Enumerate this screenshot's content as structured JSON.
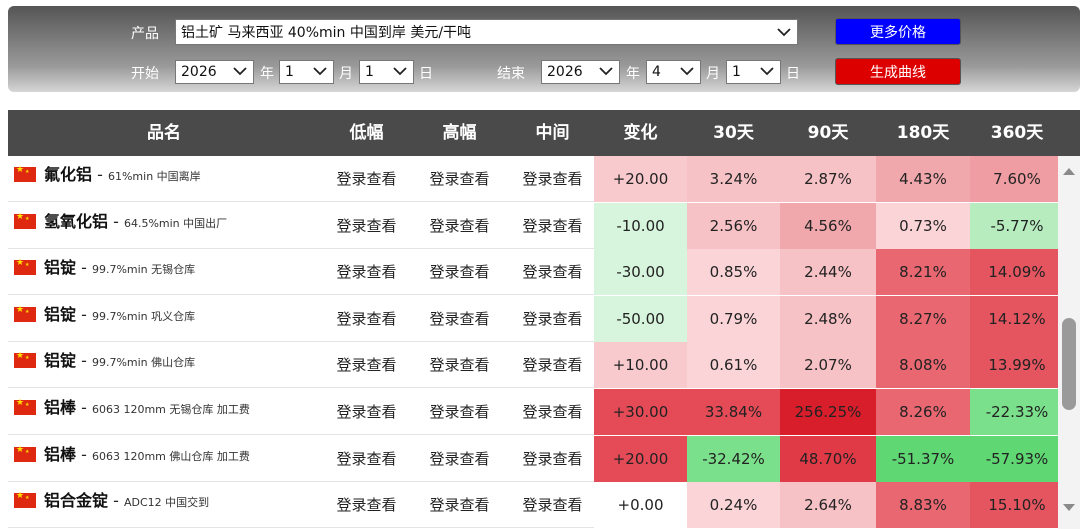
{
  "form": {
    "product_label": "产品",
    "product_value": "铝土矿 马来西亚 40%min 中国到岸 美元/干吨",
    "start_label": "开始",
    "end_label": "结束",
    "start": {
      "year": "2026",
      "month": "1",
      "day": "1"
    },
    "end": {
      "year": "2026",
      "month": "4",
      "day": "1"
    },
    "unit_year": "年",
    "unit_month": "月",
    "unit_day": "日",
    "more_price_button": "更多价格",
    "generate_curve_button": "生成曲线",
    "colors": {
      "more_price": "#0000ff",
      "generate_curve": "#dd0000"
    }
  },
  "table": {
    "headers": [
      "品名",
      "低幅",
      "高幅",
      "中间",
      "变化",
      "30天",
      "90天",
      "180天",
      "360天"
    ],
    "login_text": "登录查看",
    "rows": [
      {
        "name": "氟化铝",
        "spec": "61%min 中国离岸",
        "change": "+20.00",
        "d30": "3.24%",
        "d90": "2.87%",
        "d180": "4.43%",
        "d360": "7.60%",
        "colors": {
          "change": "#f8c9cd",
          "d30": "#f7c2c6",
          "d90": "#f7c2c6",
          "d180": "#f1a8ad",
          "d360": "#ef9ca2"
        }
      },
      {
        "name": "氢氧化铝",
        "spec": "64.5%min 中国出厂",
        "change": "-10.00",
        "d30": "2.56%",
        "d90": "4.56%",
        "d180": "0.73%",
        "d360": "-5.77%",
        "colors": {
          "change": "#d7f4dc",
          "d30": "#f7c2c6",
          "d90": "#f1a8ad",
          "d180": "#fad4d7",
          "d360": "#b7ecbf"
        }
      },
      {
        "name": "铝锭",
        "spec": "99.7%min 无锡仓库",
        "change": "-30.00",
        "d30": "0.85%",
        "d90": "2.44%",
        "d180": "8.21%",
        "d360": "14.09%",
        "colors": {
          "change": "#d7f4dc",
          "d30": "#fad4d7",
          "d90": "#f7c2c6",
          "d180": "#e86771",
          "d360": "#e45560"
        }
      },
      {
        "name": "铝锭",
        "spec": "99.7%min 巩义仓库",
        "change": "-50.00",
        "d30": "0.79%",
        "d90": "2.48%",
        "d180": "8.27%",
        "d360": "14.12%",
        "colors": {
          "change": "#d7f4dc",
          "d30": "#fad4d7",
          "d90": "#f7c2c6",
          "d180": "#e86771",
          "d360": "#e45560"
        }
      },
      {
        "name": "铝锭",
        "spec": "99.7%min 佛山仓库",
        "change": "+10.00",
        "d30": "0.61%",
        "d90": "2.07%",
        "d180": "8.08%",
        "d360": "13.99%",
        "colors": {
          "change": "#f8c9cd",
          "d30": "#fad4d7",
          "d90": "#f7c2c6",
          "d180": "#e86771",
          "d360": "#e45560"
        }
      },
      {
        "name": "铝棒",
        "spec": "6063 120mm 无锡仓库 加工费",
        "change": "+30.00",
        "d30": "33.84%",
        "d90": "256.25%",
        "d180": "8.26%",
        "d360": "-22.33%",
        "colors": {
          "change": "#e54b57",
          "d30": "#e54b57",
          "d90": "#d81e2b",
          "d180": "#e86771",
          "d360": "#7be08b"
        }
      },
      {
        "name": "铝棒",
        "spec": "6063 120mm 佛山仓库 加工费",
        "change": "+20.00",
        "d30": "-32.42%",
        "d90": "48.70%",
        "d180": "-51.37%",
        "d360": "-57.93%",
        "colors": {
          "change": "#e54b57",
          "d30": "#7be08b",
          "d90": "#e03a47",
          "d180": "#5fd873",
          "d360": "#5fd873"
        }
      },
      {
        "name": "铝合金锭",
        "spec": "ADC12 中国交到",
        "change": "+0.00",
        "d30": "0.24%",
        "d90": "2.64%",
        "d180": "8.83%",
        "d360": "15.10%",
        "colors": {
          "change": "#ffffff",
          "d30": "#fad4d7",
          "d90": "#f7c2c6",
          "d180": "#e86771",
          "d360": "#e45560"
        }
      }
    ]
  }
}
